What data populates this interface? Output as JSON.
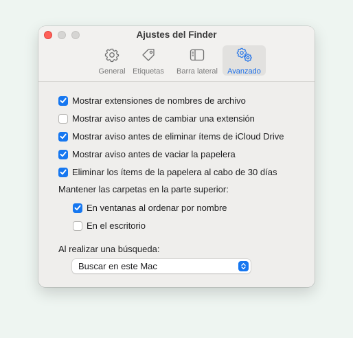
{
  "window": {
    "title": "Ajustes del Finder"
  },
  "tabs": [
    {
      "label": "General",
      "icon": "gear-icon"
    },
    {
      "label": "Etiquetas",
      "icon": "tag-icon"
    },
    {
      "label": "Barra lateral",
      "icon": "sidebar-icon"
    },
    {
      "label": "Avanzado",
      "icon": "gears-icon",
      "selected": true
    }
  ],
  "options": [
    {
      "label": "Mostrar extensiones de nombres de archivo",
      "checked": true
    },
    {
      "label": "Mostrar aviso antes de cambiar una extensión",
      "checked": false
    },
    {
      "label": "Mostrar aviso antes de eliminar ítems de iCloud Drive",
      "checked": true
    },
    {
      "label": "Mostrar aviso antes de vaciar la papelera",
      "checked": true
    },
    {
      "label": "Eliminar los ítems de la papelera al cabo de 30 días",
      "checked": true
    }
  ],
  "folders_on_top": {
    "heading": "Mantener las carpetas en la parte superior:",
    "options": [
      {
        "label": "En ventanas al ordenar por nombre",
        "checked": true
      },
      {
        "label": "En el escritorio",
        "checked": false
      }
    ]
  },
  "search": {
    "heading": "Al realizar una búsqueda:",
    "selected_value": "Buscar en este Mac"
  },
  "colors": {
    "accent": "#1677f0",
    "close": "#fe5f57",
    "window_bg": "#efeeec"
  }
}
